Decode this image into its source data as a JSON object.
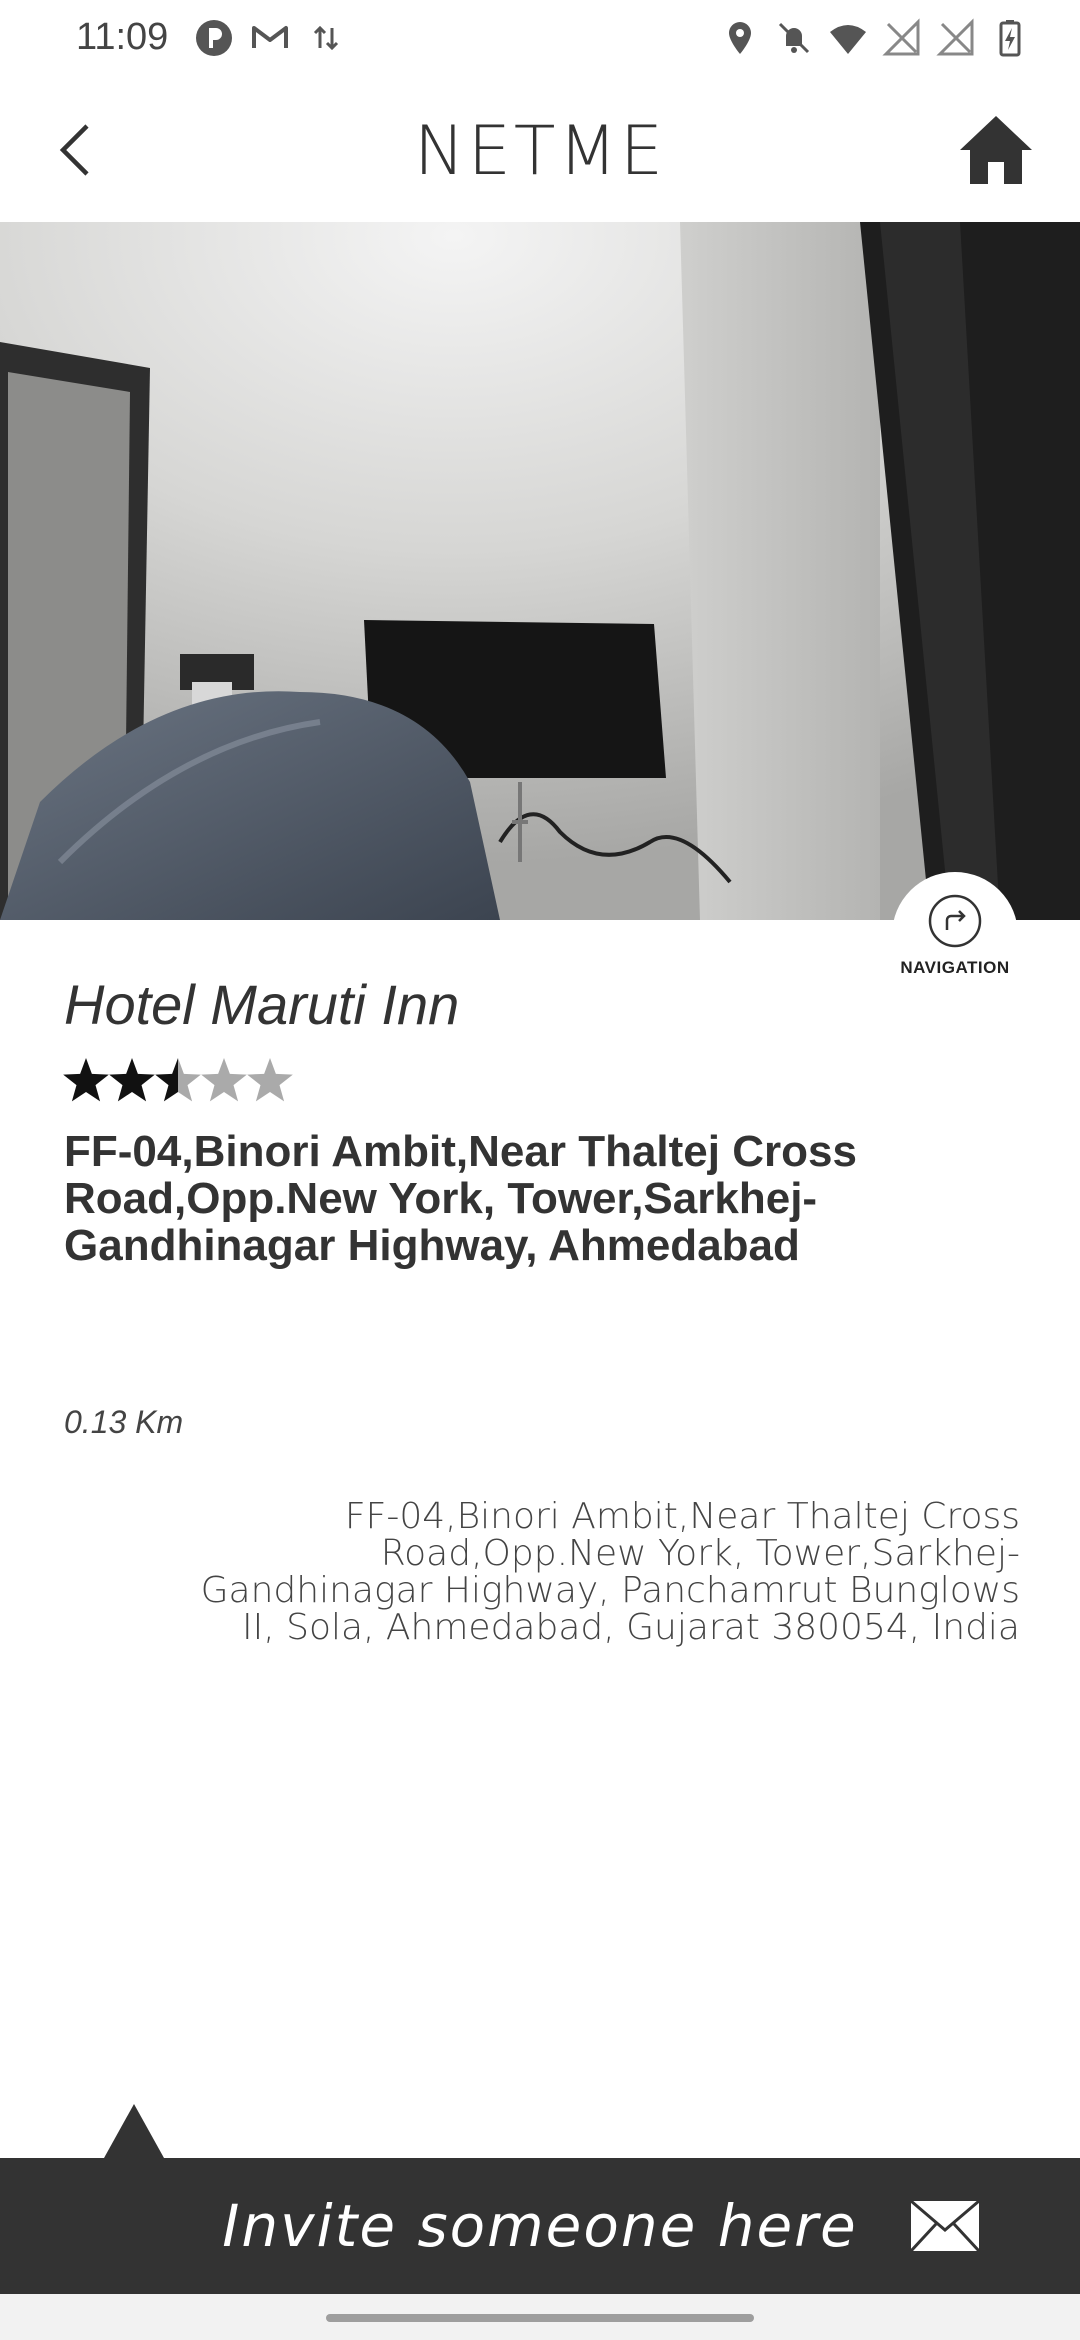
{
  "status_bar": {
    "time": "11:09",
    "left_icons": [
      "pie-app-icon",
      "gmail-icon",
      "data-transfer-icon"
    ],
    "right_icons": [
      "location-icon",
      "notifications-off-icon",
      "wifi-icon",
      "no-signal-icon",
      "no-signal-icon",
      "battery-charging-icon"
    ]
  },
  "app_bar": {
    "title": "NETME",
    "back_icon": "chevron-left-icon",
    "home_icon": "home-icon"
  },
  "hero": {
    "image_description_icon": "hotel-room-photo"
  },
  "navigation": {
    "label": "NAVIGATION",
    "icon": "turn-right-icon"
  },
  "place": {
    "name": "Hotel Maruti Inn",
    "rating": 2.5,
    "rating_max": 5,
    "address_short": "FF-04,Binori Ambit,Near Thaltej Cross Road,Opp.New York, Tower,Sarkhej-Gandhinagar Highway, Ahmedabad",
    "distance": "0.13 Km",
    "address_full": "FF-04,Binori Ambit,Near Thaltej Cross Road,Opp.New York, Tower,Sarkhej-Gandhinagar Highway, Panchamrut Bunglows II, Sola, Ahmedabad, Gujarat 380054, India"
  },
  "invite": {
    "label": "Invite someone here",
    "icon": "mail-icon"
  },
  "colors": {
    "invite_bar": "#333333",
    "text_dark": "#333333",
    "star_filled": "#111111",
    "star_empty": "#aaaaaa"
  }
}
